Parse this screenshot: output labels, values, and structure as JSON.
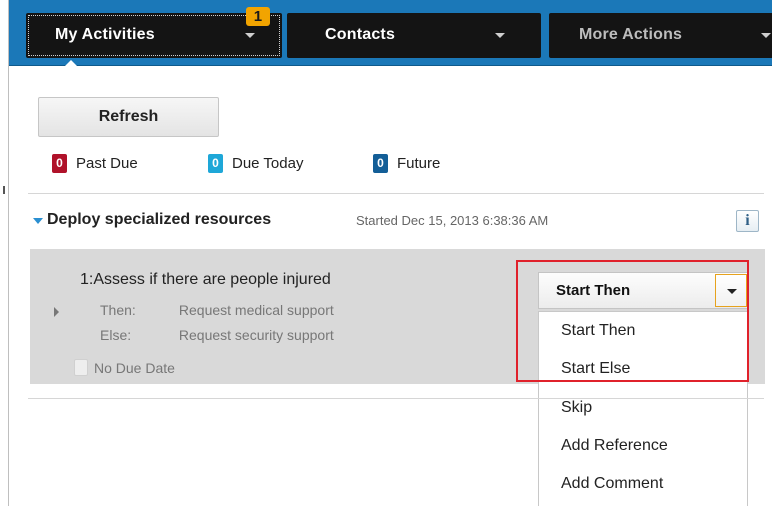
{
  "toolbar": {
    "tabs": {
      "my_activities": {
        "label": "My Activities",
        "badge": "1"
      },
      "contacts": {
        "label": "Contacts"
      },
      "more_actions": {
        "label": "More Actions"
      }
    }
  },
  "main": {
    "refresh_label": "Refresh",
    "counters": {
      "past_due": {
        "count": "0",
        "label": "Past Due",
        "color": "#b0122a"
      },
      "due_today": {
        "count": "0",
        "label": "Due Today",
        "color": "#1ea7d8"
      },
      "future": {
        "count": "0",
        "label": "Future",
        "color": "#135e97"
      }
    },
    "task": {
      "title": "Deploy specialized resources",
      "started": "Started Dec 15, 2013 6:38:36 AM",
      "info_label": "i",
      "activity": {
        "title": "1:Assess if there are people injured",
        "then_key": "Then:",
        "then_value": "Request medical support",
        "else_key": "Else:",
        "else_value": "Request security support",
        "due": "No Due Date"
      }
    },
    "action_button": {
      "label": "Start Then"
    },
    "menu": {
      "items": [
        "Start Then",
        "Start Else",
        "Skip",
        "Add Reference",
        "Add Comment"
      ]
    }
  },
  "colors": {
    "toolbar_bg": "#1b78b8",
    "highlight": "#e0212b",
    "badge": "#f2a400"
  }
}
